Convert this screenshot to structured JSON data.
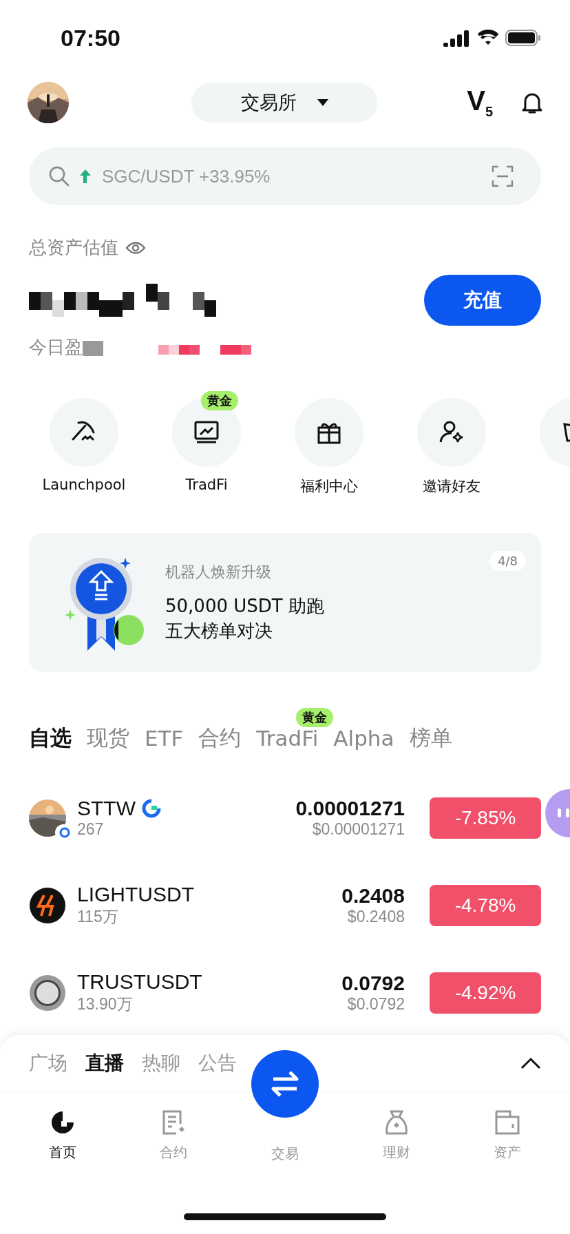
{
  "status_bar": {
    "time": "07:50"
  },
  "header": {
    "selector": "交易所",
    "level_badge": "V$_{5}$"
  },
  "search": {
    "placeholder": "SGC/USDT +33.95%"
  },
  "assets": {
    "label": "总资产估值",
    "deposit_button": "充值",
    "today_pnl_label": "今日盈"
  },
  "shortcuts": [
    {
      "label": "Launchpool",
      "kind": "pickaxe"
    },
    {
      "label": "TradFi",
      "kind": "chart",
      "badge": "黄金"
    },
    {
      "label": "福利中心",
      "kind": "gift"
    },
    {
      "label": "邀请好友",
      "kind": "invite"
    },
    {
      "kind": "cup"
    }
  ],
  "banner": {
    "subtitle": "机器人焕新升级",
    "lines": [
      "50,000 USDT 助跑",
      "五大榜单对决"
    ],
    "counter": "4/8"
  },
  "market_tabs": [
    {
      "label": "自选",
      "selected": true
    },
    {
      "label": "现货",
      "selected": false
    },
    {
      "label": "ETF",
      "selected": false
    },
    {
      "label": "合约",
      "selected": false
    },
    {
      "label": "TradFi",
      "selected": false,
      "badge": "黄金"
    },
    {
      "label": "Alpha",
      "selected": false
    },
    {
      "label": "榜单",
      "selected": false
    }
  ],
  "markets": [
    {
      "symbol": "STTW",
      "kind": "picture",
      "verified": true,
      "volume": "267",
      "price": "0.00001271",
      "price_usd": "$0.00001271",
      "change": "-7.85%"
    },
    {
      "symbol": "LIGHTUSDT",
      "kind": "bolt",
      "verified": false,
      "volume": "115万",
      "price": "0.2408",
      "price_usd": "$0.2408",
      "change": "-4.78%"
    },
    {
      "symbol": "TRUSTUSDT",
      "kind": "coin",
      "verified": false,
      "volume": "13.90万",
      "price": "0.0792",
      "price_usd": "$0.0792",
      "change": "-4.92%"
    }
  ],
  "feed_tabs": [
    {
      "label": "广场",
      "selected": false
    },
    {
      "label": "直播",
      "selected": true
    },
    {
      "label": "热聊",
      "selected": false
    },
    {
      "label": "公告",
      "selected": false
    }
  ],
  "bottom_nav": [
    {
      "label": "首页",
      "kind": "home",
      "selected": true
    },
    {
      "label": "合约",
      "kind": "contract",
      "selected": false
    },
    {
      "label": "交易",
      "kind": "trade",
      "selected": false
    },
    {
      "label": "理财",
      "kind": "earn",
      "selected": false
    },
    {
      "label": "资产",
      "kind": "wallet",
      "selected": false
    }
  ]
}
